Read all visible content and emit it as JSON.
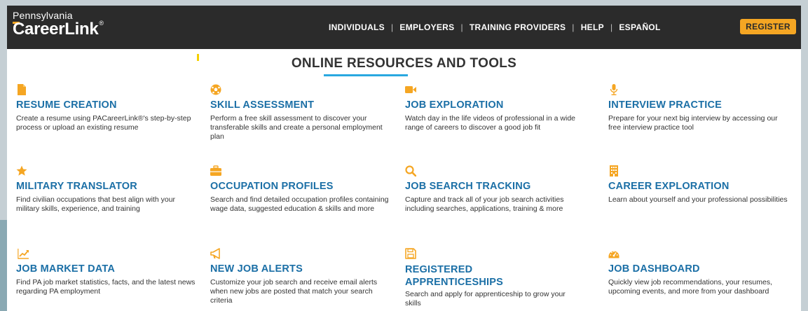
{
  "header": {
    "logo_top": "Pennsylvania",
    "logo_main": "CareerLink",
    "logo_reg": "®",
    "nav": [
      "INDIVIDUALS",
      "EMPLOYERS",
      "TRAINING PROVIDERS",
      "HELP",
      "ESPAÑOL"
    ],
    "register_label": "REGISTER"
  },
  "section_title": "ONLINE RESOURCES AND TOOLS",
  "colors": {
    "accent": "#f5a623",
    "title_blue": "#1b6fa6",
    "header_bg": "#2b2b2b",
    "underline": "#29a8e0"
  },
  "resources": [
    {
      "icon": "document-icon",
      "title": "RESUME CREATION",
      "desc": "Create a resume using PACareerLink®'s step-by-step process or upload an existing resume"
    },
    {
      "icon": "soccer-ball-icon",
      "title": "SKILL ASSESSMENT",
      "desc": "Perform a free skill assessment to discover your transferable skills and create a personal employment plan"
    },
    {
      "icon": "video-camera-icon",
      "title": "JOB EXPLORATION",
      "desc": "Watch day in the life videos of professional in a wide range of careers to discover a good job fit"
    },
    {
      "icon": "microphone-icon",
      "title": "INTERVIEW PRACTICE",
      "desc": "Prepare for your next big interview by accessing our free interview practice tool"
    },
    {
      "icon": "star-icon",
      "title": "MILITARY TRANSLATOR",
      "desc": "Find civilian occupations that best align with your military skills, experience, and training"
    },
    {
      "icon": "briefcase-icon",
      "title": "OCCUPATION PROFILES",
      "desc": "Search and find detailed occupation profiles containing wage data, suggested education & skills and more"
    },
    {
      "icon": "magnifier-icon",
      "title": "JOB SEARCH TRACKING",
      "desc": "Capture and track all of your job search activities including searches, applications, training & more"
    },
    {
      "icon": "building-icon",
      "title": "CAREER EXPLORATION",
      "desc": "Learn about yourself and your professional possibilities"
    },
    {
      "icon": "line-chart-icon",
      "title": "JOB MARKET DATA",
      "desc": "Find PA job market statistics, facts, and the latest news regarding PA employment"
    },
    {
      "icon": "megaphone-icon",
      "title": "NEW JOB ALERTS",
      "desc": "Customize your job search and receive email alerts when new jobs are posted that match your search criteria"
    },
    {
      "icon": "floppy-disk-icon",
      "title": "REGISTERED APPRENTICESHIPS",
      "desc": "Search and apply for apprenticeship to grow your skills"
    },
    {
      "icon": "dashboard-gauge-icon",
      "title": "JOB DASHBOARD",
      "desc": "Quickly view job recommendations, your resumes, upcoming events, and more from your dashboard"
    }
  ]
}
